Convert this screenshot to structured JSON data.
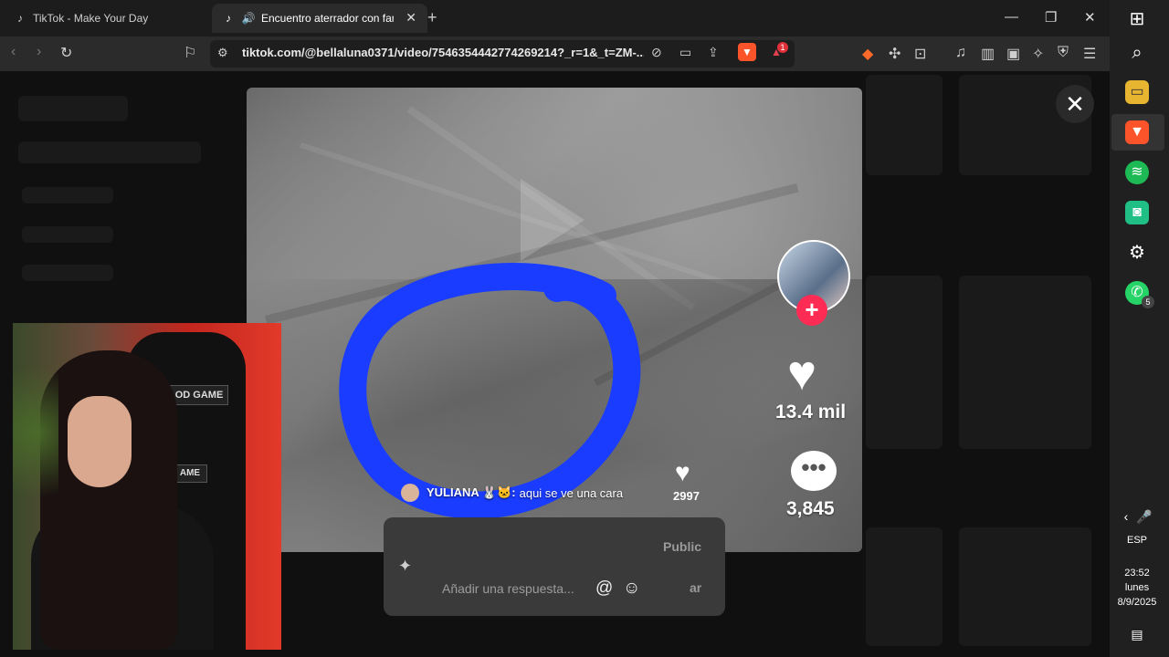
{
  "browser": {
    "tabs": [
      {
        "title": "TikTok - Make Your Day",
        "active": false
      },
      {
        "title": "Encuentro aterrador con fantasma",
        "active": true
      }
    ],
    "url": "tiktok.com/@bellaluna0371/video/7546354442774269214?_r=1&_t=ZM-...",
    "brave_badge_count": "1"
  },
  "video": {
    "likes": "13.4 mil",
    "comments": "3,845",
    "overlay_comment": {
      "author": "YULIANA 🐰🐱:",
      "text": "aqui se ve una cara",
      "likes": "2997"
    }
  },
  "reply": {
    "visibility": "Public",
    "placeholder": "Añadir una respuesta...",
    "post_label": "ar"
  },
  "webcam": {
    "chair_text_top": "OD GAME",
    "chair_text_bottom": "AME"
  },
  "taskbar": {
    "language": "ESP",
    "time": "23:52",
    "day": "lunes",
    "date": "8/9/2025",
    "whatsapp_badge": "5"
  },
  "colors": {
    "tiktok_red": "#fe2c55",
    "annotation_blue": "#1a3cff",
    "spotify": "#1db954",
    "whatsapp": "#25d366"
  }
}
